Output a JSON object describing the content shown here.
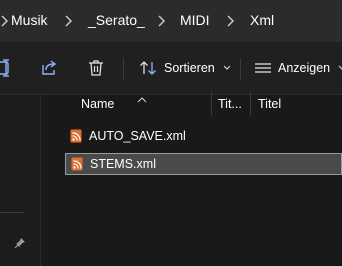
{
  "window": {
    "accent": "#e07030",
    "background": "#191919"
  },
  "address_bar": {
    "crumbs": [
      "Musik",
      "_Serato_",
      "MIDI",
      "Xml"
    ],
    "separator_icon": "chevron-right-icon"
  },
  "command_bar": {
    "tools": [
      {
        "icon": "rename-icon"
      },
      {
        "icon": "share-icon"
      },
      {
        "icon": "trash-icon"
      }
    ],
    "sort": {
      "label": "Sortieren",
      "icon": "sort-icon"
    },
    "view": {
      "label": "Anzeigen",
      "icon": "view-list-icon"
    }
  },
  "file_list": {
    "columns": {
      "name": "Name",
      "title_short": "Tit...",
      "title": "Titel"
    },
    "files": [
      {
        "name": "AUTO_SAVE.xml",
        "icon": "xml-file-icon",
        "selected": false
      },
      {
        "name": "STEMS.xml",
        "icon": "xml-file-icon",
        "selected": true
      }
    ]
  }
}
